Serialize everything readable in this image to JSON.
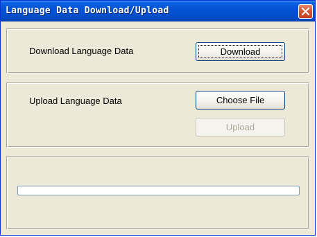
{
  "window": {
    "title": "Language Data Download/Upload"
  },
  "download_section": {
    "label": "Download Language Data",
    "button_label": "Download"
  },
  "upload_section": {
    "label": "Upload Language Data",
    "choose_file_label": "Choose File",
    "upload_label": "Upload"
  },
  "progress": {
    "value": 0
  },
  "colors": {
    "title_bar": "#0553d6",
    "close_button": "#d45a36",
    "dialog_background": "#ece9d8",
    "disabled_text": "#aca899"
  },
  "icons": {
    "close": "close-x-icon"
  }
}
